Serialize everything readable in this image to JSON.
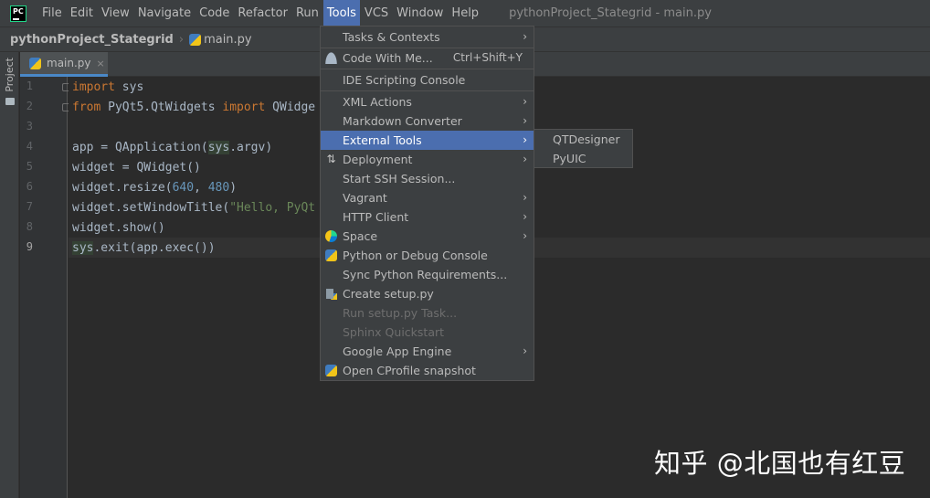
{
  "app": {
    "logo_text": "PC",
    "window_title": "pythonProject_Stategrid - main.py"
  },
  "menubar": [
    {
      "label": "File"
    },
    {
      "label": "Edit"
    },
    {
      "label": "View"
    },
    {
      "label": "Navigate"
    },
    {
      "label": "Code"
    },
    {
      "label": "Refactor"
    },
    {
      "label": "Run"
    },
    {
      "label": "Tools",
      "active": true
    },
    {
      "label": "VCS"
    },
    {
      "label": "Window"
    },
    {
      "label": "Help"
    }
  ],
  "breadcrumb": {
    "project": "pythonProject_Stategrid",
    "file": "main.py"
  },
  "toolstrip": {
    "project_tab": "Project"
  },
  "editor_tab": {
    "name": "main.py",
    "close": "×"
  },
  "editor": {
    "line_numbers": [
      "1",
      "2",
      "3",
      "4",
      "5",
      "6",
      "7",
      "8",
      "9"
    ],
    "current_line": "9",
    "lines": {
      "l1_kw": "import",
      "l1_mod": "sys",
      "l2_kw1": "from",
      "l2_mod": " PyQt5.QtWidgets ",
      "l2_kw2": "import",
      "l2_rest": " QWidge",
      "l4_a": "app = QApplication(",
      "l4_hl": "sys",
      "l4_b": ".argv)",
      "l5": "widget = QWidget()",
      "l6_a": "widget.resize(",
      "l6_n1": "640",
      "l6_b": ", ",
      "l6_n2": "480",
      "l6_c": ")",
      "l7_a": "widget.setWindowTitle(",
      "l7_str": "\"Hello, PyQt",
      "l8": "widget.show()",
      "l9_hl": "sys",
      "l9_rest": ".exit(app.exec())"
    }
  },
  "tools_menu": {
    "items": [
      {
        "label": "Tasks & Contexts",
        "submenu": true
      },
      {
        "label": "Code With Me...",
        "shortcut": "Ctrl+Shift+Y",
        "icon": "user-icon"
      },
      {
        "label": "IDE Scripting Console"
      },
      {
        "label": "XML Actions",
        "submenu": true
      },
      {
        "label": "Markdown Converter",
        "submenu": true
      },
      {
        "label": "External Tools",
        "submenu": true,
        "selected": true
      },
      {
        "label": "Deployment",
        "submenu": true,
        "icon": "deployment-icon"
      },
      {
        "label": "Start SSH Session..."
      },
      {
        "label": "Vagrant",
        "submenu": true
      },
      {
        "label": "HTTP Client",
        "submenu": true
      },
      {
        "label": "Space",
        "submenu": true,
        "icon": "space-icon"
      },
      {
        "label": "Python or Debug Console",
        "icon": "python-console-icon"
      },
      {
        "label": "Sync Python Requirements..."
      },
      {
        "label": "Create setup.py",
        "icon": "setup-py-icon"
      },
      {
        "label": "Run setup.py Task...",
        "disabled": true
      },
      {
        "label": "Sphinx Quickstart",
        "disabled": true
      },
      {
        "label": "Google App Engine",
        "submenu": true
      },
      {
        "label": "Open CProfile snapshot",
        "icon": "cprofile-icon"
      }
    ],
    "arrow": "›"
  },
  "external_tools_submenu": [
    {
      "label": "QTDesigner"
    },
    {
      "label": "PyUIC"
    }
  ],
  "watermark": "知乎 @北国也有红豆",
  "colors": {
    "menubar_bg": "#3c3f41",
    "editor_bg": "#2b2b2b",
    "selection": "#4b6eaf",
    "keyword": "#cc7832",
    "number": "#6897bb",
    "string": "#6a8759"
  }
}
